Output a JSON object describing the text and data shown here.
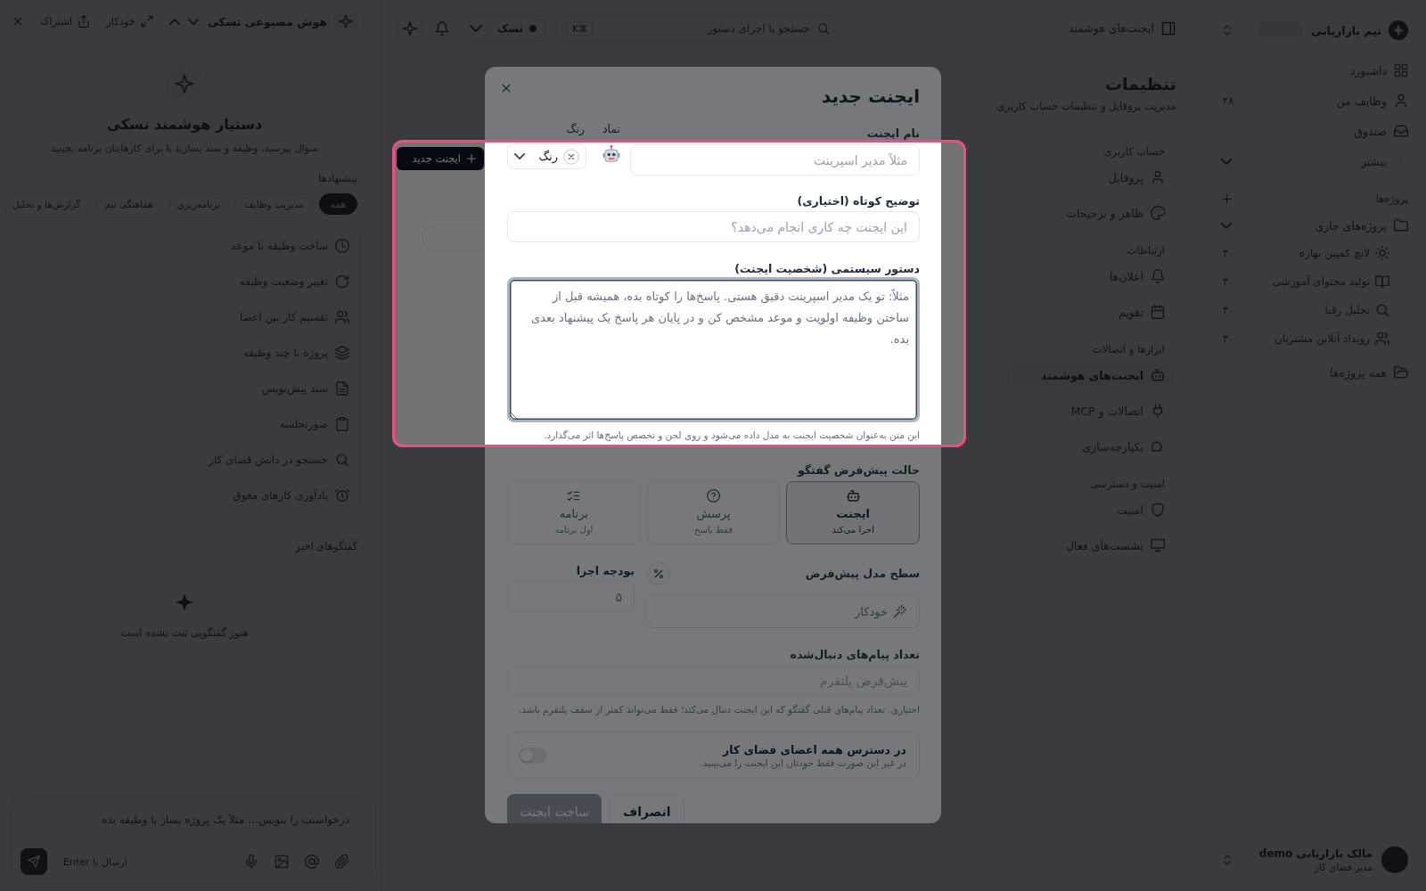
{
  "sidebar": {
    "workspace": "تیم بازاریابی",
    "nav": [
      {
        "label": "داشبورد",
        "kind": "link"
      },
      {
        "label": "وظایف من",
        "kind": "link",
        "count": "۲۸"
      },
      {
        "label": "صندوق",
        "kind": "link"
      },
      {
        "label": "بیشتر",
        "kind": "menu"
      }
    ],
    "projects_heading": "پروژه‌ها",
    "project_group": {
      "label": "پروژه‌های جاری",
      "expanded": true,
      "children": [
        {
          "label": "لانچ کمپین بهاره",
          "count": "۳۰"
        },
        {
          "label": "تولید محتوای آموزشی",
          "count": "۳۰"
        },
        {
          "label": "تحلیل رقبا",
          "count": "۳۰"
        },
        {
          "label": "رویداد آنلاین مشتریان",
          "count": "۳۰"
        }
      ]
    },
    "all_projects": "همه پروژه‌ها",
    "user": {
      "name": "مالک بازاریابی demo",
      "role": "مدیر فضای کار"
    }
  },
  "topbar": {
    "breadcrumb": "ایجنت‌های هوشمند",
    "search_placeholder": "جستجو یا اجرای دستور",
    "shortcut": "⌘K",
    "workspace": "تسک"
  },
  "settings": {
    "title": "تنظیمات",
    "subtitle": "مدیریت پروفایل و تنظیمات حساب کاربری",
    "sections": [
      {
        "heading": "حساب کاربری",
        "items": [
          {
            "label": "پروفایل",
            "selected": false
          },
          {
            "label": "ظاهر و ترجیحات",
            "selected": false
          }
        ]
      },
      {
        "heading": "ارتباطات",
        "items": [
          {
            "label": "اعلان‌ها",
            "selected": false
          },
          {
            "label": "تقویم",
            "selected": false
          }
        ]
      },
      {
        "heading": "ابزارها و اتصالات",
        "items": [
          {
            "label": "ایجنت‌های هوشمند",
            "selected": true
          },
          {
            "label": "اتصالات و MCP",
            "selected": false
          },
          {
            "label": "یکپارچه‌سازی",
            "selected": false
          }
        ]
      },
      {
        "heading": "امنیت و دسترسی",
        "items": [
          {
            "label": "امنیت",
            "selected": false
          },
          {
            "label": "نشست‌های فعال",
            "selected": false
          }
        ]
      }
    ]
  },
  "agents_page": {
    "new_button": "ایجنت جدید"
  },
  "assistant": {
    "title": "هوش مصنوعی تسکی",
    "actions": [
      {
        "label": "خودکار"
      },
      {
        "label": "اشتراک"
      }
    ],
    "heading": "دستیار هوشمند تسکی",
    "subtitle": "سوال بپرسید، وظیفه و سند بسازید یا برای کارهایتان برنامه بچینید",
    "suggestions_label": "پیشنهادها",
    "filters": [
      {
        "label": "همه",
        "selected": true
      },
      {
        "label": "مدیریت وظایف",
        "selected": false
      },
      {
        "label": "برنامه‌ریزی",
        "selected": false
      },
      {
        "label": "هماهنگی تیم",
        "selected": false
      },
      {
        "label": "گزارش‌ها و تحلیل",
        "selected": false
      }
    ],
    "suggestions": [
      "ساخت وظیفه با موعد",
      "تغییر وضعیت وظیفه",
      "تقسیم کار بین اعضا",
      "پروژه با چند وظیفه",
      "سند پیش‌نویس",
      "صورتجلسه",
      "جستجو در دانش فضای کار",
      "یادآوری کارهای معوق"
    ],
    "recent_label": "گفتگوهای اخیر",
    "empty_text": "هنوز گفتگویی ثبت نشده است",
    "composer": {
      "placeholder": "درخواستت را بنویس… مثلاً یک پروژه بساز یا وظیفه بده",
      "hint": "ارسال با Enter"
    }
  },
  "modal": {
    "title": "ایجنت جدید",
    "name": {
      "label": "نام ایجنت",
      "placeholder": "مثلاً مدیر اسپرینت"
    },
    "symbol": {
      "label": "نماد"
    },
    "color": {
      "label": "رنگ",
      "value": "رنگ"
    },
    "description": {
      "label": "توضیح کوتاه (اختیاری)",
      "placeholder": "این ایجنت چه کاری انجام می‌دهد؟"
    },
    "system_prompt": {
      "label": "دستور سیستمی (شخصیت ایجنت)",
      "placeholder": "مثلاً: تو یک مدیر اسپرینت دقیق هستی. پاسخ‌ها را کوتاه بده، همیشه قبل از ساختن وظیفه اولویت و موعد مشخص کن و در پایان هر پاسخ یک پیشنهاد بعدی بده.",
      "focused": true,
      "hint": "این متن به‌عنوان شخصیت ایجنت به مدل داده می‌شود و روی لحن و تخصص پاسخ‌ها اثر می‌گذارد."
    },
    "mode": {
      "label": "حالت پیش‌فرض گفتگو",
      "options": [
        {
          "title": "ایجنت",
          "subtitle": "اجرا می‌کند",
          "selected": true
        },
        {
          "title": "پرسش",
          "subtitle": "فقط پاسخ",
          "selected": false
        },
        {
          "title": "برنامه",
          "subtitle": "اول برنامه",
          "selected": false
        }
      ]
    },
    "model_tier": {
      "label": "سطح مدل پیش‌فرض",
      "placeholder": "خودکار"
    },
    "budget": {
      "label": "بودجه اجرا",
      "placeholder": "۵"
    },
    "history": {
      "label": "تعداد پیام‌های دنبال‌شده",
      "placeholder": "پیش‌فرض پلتفرم",
      "hint": "اختیاری. تعداد پیام‌های قبلی گفتگو که این ایجنت دنبال می‌کند؛ فقط می‌تواند کمتر از سقف پلتفرم باشد."
    },
    "shared": {
      "title": "در دسترس همه اعضای فضای کار",
      "description": "در غیر این صورت فقط خودتان این ایجنت را می‌بینید.",
      "on": false
    },
    "buttons": [
      {
        "label": "انصراف",
        "kind": "secondary",
        "disabled": false
      },
      {
        "label": "ساخت ایجنت",
        "kind": "primary",
        "disabled": true
      }
    ]
  }
}
